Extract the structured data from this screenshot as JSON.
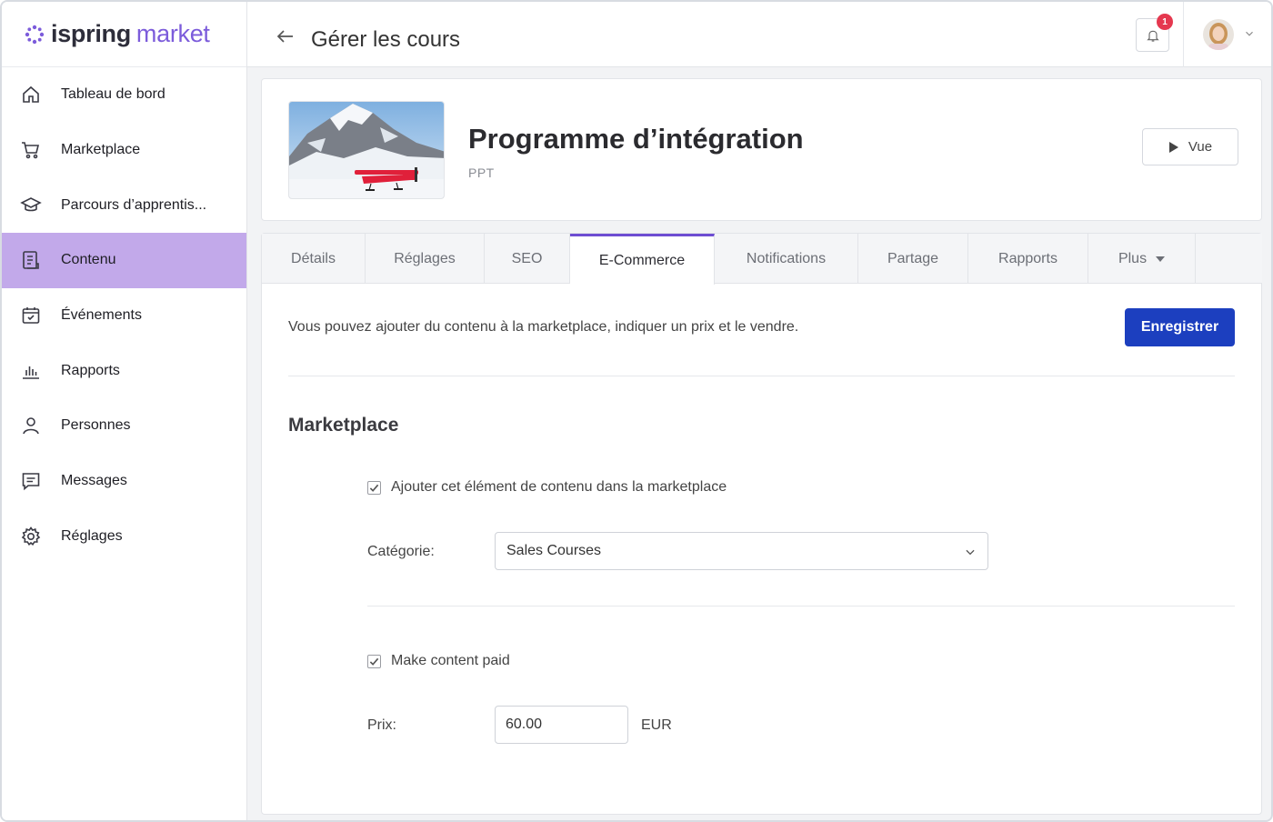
{
  "brand": {
    "word1": "ispring",
    "word2": "market",
    "accent": "#7c5cdb"
  },
  "sidebar": {
    "items": [
      {
        "label": "Tableau de bord",
        "icon": "home-icon"
      },
      {
        "label": "Marketplace",
        "icon": "cart-icon"
      },
      {
        "label": "Parcours d’apprentis...",
        "icon": "graduation-cap-icon"
      },
      {
        "label": "Contenu",
        "icon": "document-icon",
        "active": true
      },
      {
        "label": "Événements",
        "icon": "calendar-icon"
      },
      {
        "label": "Rapports",
        "icon": "bar-chart-icon"
      },
      {
        "label": "Personnes",
        "icon": "person-icon"
      },
      {
        "label": "Messages",
        "icon": "message-icon"
      },
      {
        "label": "Réglages",
        "icon": "gear-icon"
      }
    ],
    "active_color": "#c2a9ea"
  },
  "header": {
    "title": "Gérer les cours",
    "notification_count": "1"
  },
  "course": {
    "title": "Programme d’intégration",
    "type": "PPT",
    "view_label": "Vue"
  },
  "tabs": [
    {
      "label": "Détails"
    },
    {
      "label": "Réglages"
    },
    {
      "label": "SEO"
    },
    {
      "label": "E-Commerce",
      "active": true
    },
    {
      "label": "Notifications"
    },
    {
      "label": "Partage"
    },
    {
      "label": "Rapports"
    },
    {
      "label": "Plus"
    }
  ],
  "ecommerce": {
    "info": "Vous pouvez ajouter du contenu à la marketplace, indiquer un prix et le vendre.",
    "save_label": "Enregistrer",
    "save_color": "#1c3fbf",
    "section_title": "Marketplace",
    "add_to_marketplace_label": "Ajouter cet élément de contenu dans la marketplace",
    "add_to_marketplace_checked": true,
    "category_label": "Catégorie:",
    "category_value": "Sales Courses",
    "paid_label": "Make content paid",
    "paid_checked": true,
    "price_label": "Prix:",
    "price_value": "60.00",
    "currency": "EUR"
  }
}
